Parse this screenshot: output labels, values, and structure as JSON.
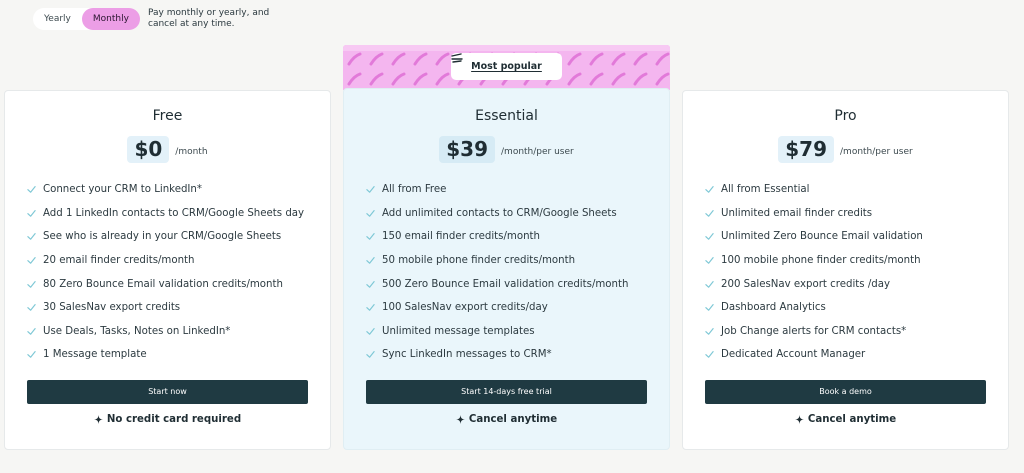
{
  "billing": {
    "options": [
      "Yearly",
      "Monthly"
    ],
    "selected": "Monthly",
    "note": "Pay monthly or yearly, and cancel at any time."
  },
  "banner": {
    "label": "Most popular",
    "color": "#f4b6ef"
  },
  "plans": [
    {
      "name": "Free",
      "price": "$0",
      "unit": "/month",
      "features": [
        "Connect your CRM to LinkedIn*",
        "Add 1 LinkedIn contacts to CRM/Google Sheets day",
        "See who is already in your CRM/Google Sheets",
        "20 email finder credits/month",
        "80 Zero Bounce Email validation credits/month",
        "30 SalesNav export credits",
        "Use Deals, Tasks, Notes on LinkedIn*",
        "1 Message template"
      ],
      "cta": "Start now",
      "note": "No credit card required"
    },
    {
      "name": "Essential",
      "price": "$39",
      "unit": "/month/per user",
      "features": [
        "All from Free",
        "Add unlimited contacts to CRM/Google Sheets",
        "150 email finder credits/month",
        "50 mobile phone finder credits/month",
        "500 Zero Bounce Email validation credits/month",
        "100 SalesNav export credits/day",
        "Unlimited message templates",
        "Sync LinkedIn messages to CRM*"
      ],
      "cta": "Start 14-days free trial",
      "note": "Cancel anytime"
    },
    {
      "name": "Pro",
      "price": "$79",
      "unit": "/month/per user",
      "features": [
        "All from Essential",
        "Unlimited email finder credits",
        "Unlimited Zero Bounce Email validation",
        "100 mobile phone finder credits/month",
        "200 SalesNav export credits /day",
        "Dashboard Analytics",
        "Job Change alerts for CRM contacts*",
        "Dedicated Account Manager"
      ],
      "cta": "Book a demo",
      "note": "Cancel anytime"
    }
  ],
  "colors": {
    "accent": "#ec9ee6",
    "button": "#1f3a42",
    "check": "#7fc8d6",
    "highlight_card": "#eaf6fb"
  },
  "icons": {
    "feature": "check-icon",
    "note": "sparkle-icon",
    "banner": "squiggle-icon"
  }
}
